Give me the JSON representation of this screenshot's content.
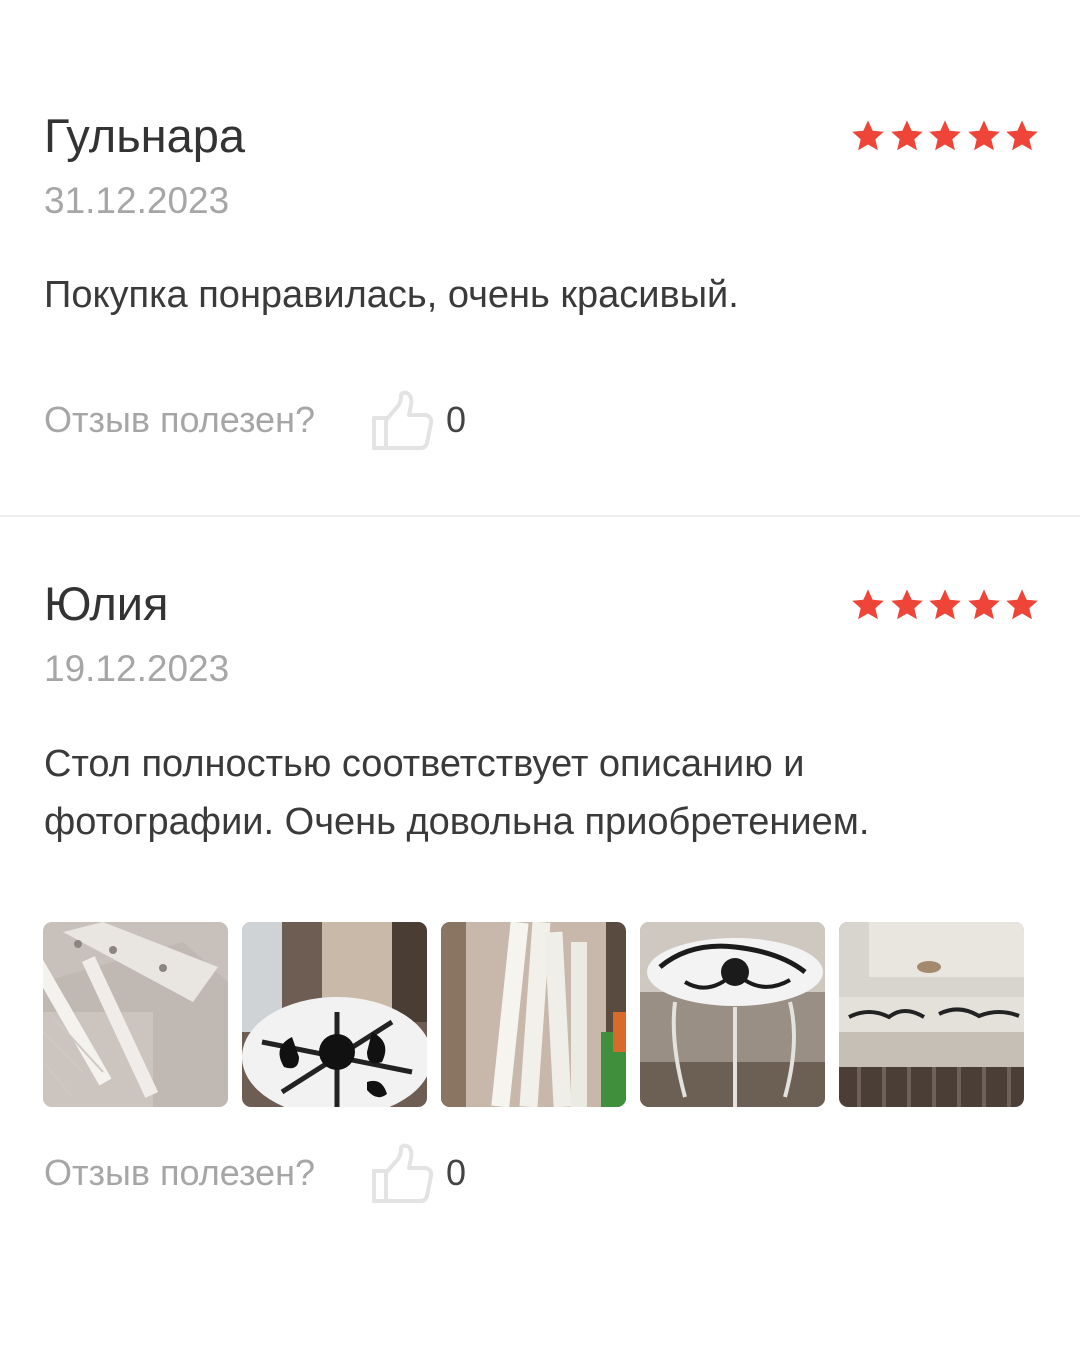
{
  "reviews": [
    {
      "author": "Гульнара",
      "date": "31.12.2023",
      "rating": 5,
      "text": "Покупка понравилась, очень красивый.",
      "helpful_label": "Отзыв полезен?",
      "likes": "0"
    },
    {
      "author": "Юлия",
      "date": "19.12.2023",
      "rating": 5,
      "text": "Стол полностью соответствует описанию и фотографии. Очень довольна приобретением.",
      "helpful_label": "Отзыв полезен?",
      "likes": "0",
      "photos_count": 5
    }
  ],
  "icons": {
    "rating": "star-icon",
    "like": "thumbs-up-icon"
  },
  "colors": {
    "star": "#ef4438",
    "author": "#333333",
    "muted": "#a6a6a6",
    "divider": "#ececec"
  }
}
